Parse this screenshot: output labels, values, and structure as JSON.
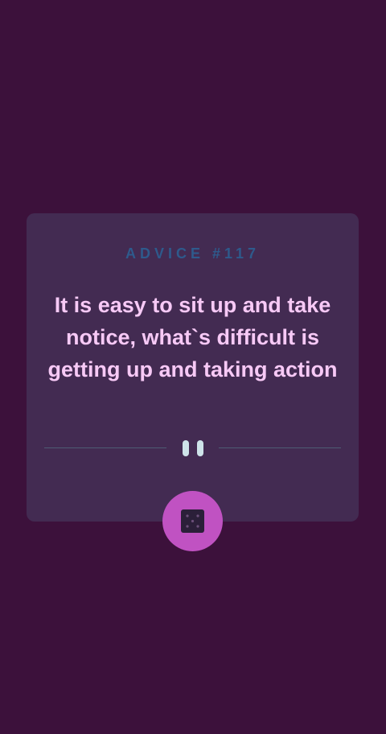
{
  "advice": {
    "id_label": "ADVICE #117",
    "quote": "It is easy to sit up and take notice, what`s difficult is getting up and taking action"
  },
  "divider": {
    "icon": "pause-icon"
  },
  "dice_button": {
    "icon": "dice-icon"
  },
  "colors": {
    "background": "#3c113b",
    "card": "#432b52",
    "id_label": "#2e5a8c",
    "quote": "#f7c9f6",
    "button": "#c052c2",
    "divider": "#4e5d73"
  }
}
